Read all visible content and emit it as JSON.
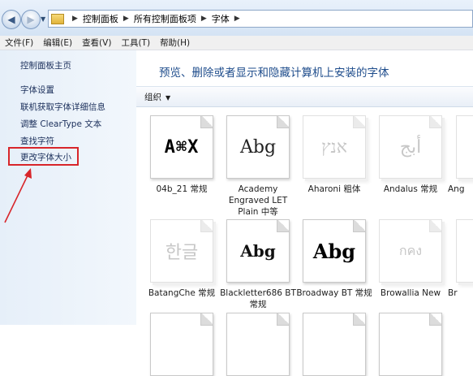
{
  "breadcrumb": [
    "控制面板",
    "所有控制面板项",
    "字体"
  ],
  "menu": [
    "文件(F)",
    "编辑(E)",
    "查看(V)",
    "工具(T)",
    "帮助(H)"
  ],
  "left_links": [
    "控制面板主页",
    "字体设置",
    "联机获取字体详细信息",
    "调整 ClearType 文本",
    "查找字符",
    "更改字体大小"
  ],
  "heading": "预览、删除或者显示和隐藏计算机上安装的字体",
  "organize_label": "组织",
  "fonts": [
    {
      "name": "04b_21 常规",
      "sample": "A⌘X",
      "style": "pixel",
      "hidden": false
    },
    {
      "name": "Academy Engraved LET Plain 中等",
      "sample": "Abg",
      "style": "normal",
      "hidden": false
    },
    {
      "name": "Aharoni 粗体",
      "sample": "אנץ",
      "style": "faded",
      "hidden": true
    },
    {
      "name": "Andalus 常规",
      "sample": "أبج",
      "style": "faded",
      "hidden": true
    },
    {
      "name": "Ang",
      "sample": "",
      "style": "faded",
      "hidden": true
    },
    {
      "name": "BatangChe 常规",
      "sample": "한글",
      "style": "faded",
      "hidden": true
    },
    {
      "name": "Blackletter686 BT 常规",
      "sample": "Abg",
      "style": "gothic",
      "hidden": false
    },
    {
      "name": "Broadway BT 常规",
      "sample": "Abg",
      "style": "bold",
      "hidden": false
    },
    {
      "name": "Browallia New",
      "sample": "กคง",
      "style": "faded",
      "hidden": true
    },
    {
      "name": "Br",
      "sample": "",
      "style": "faded",
      "hidden": true
    }
  ]
}
